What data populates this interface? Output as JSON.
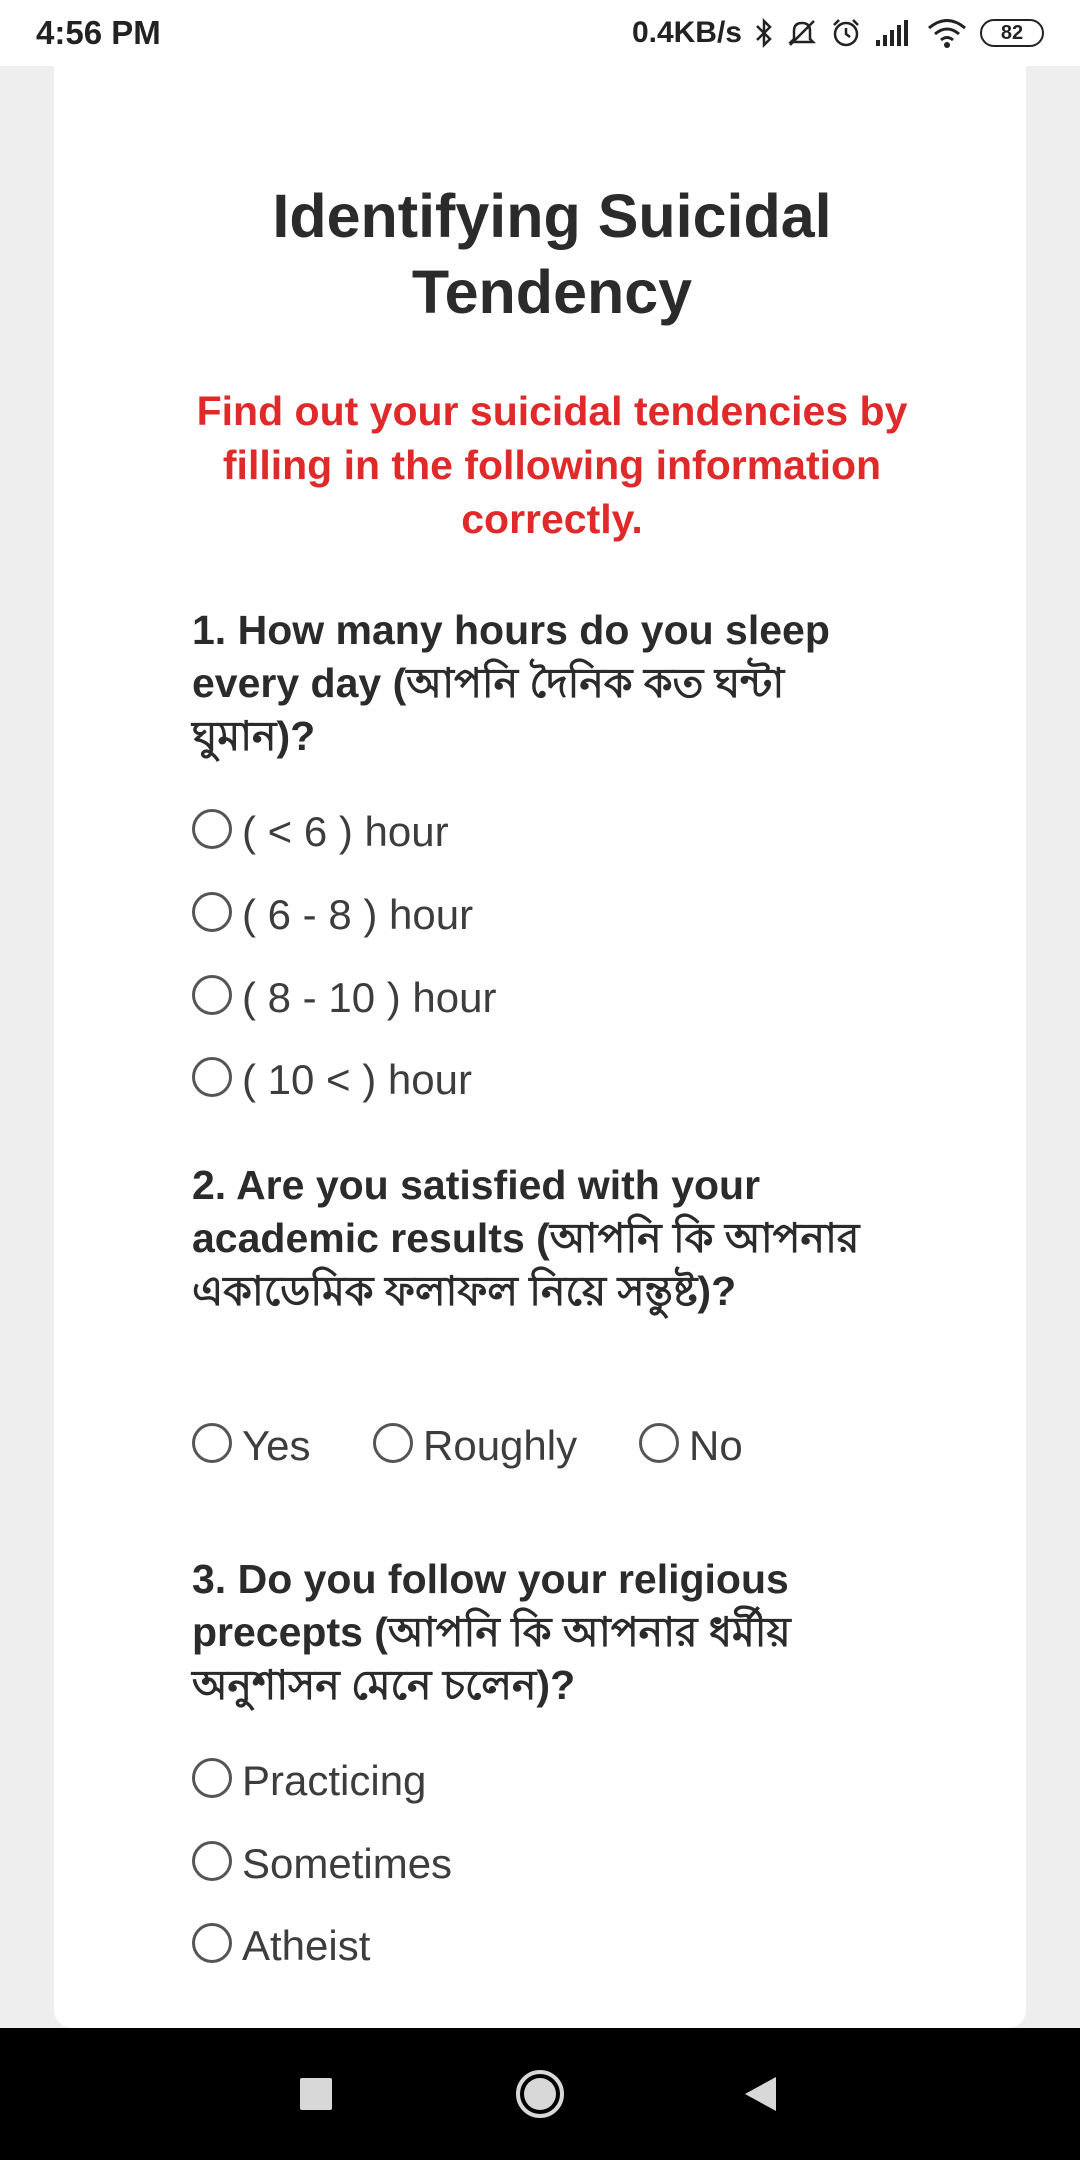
{
  "status_bar": {
    "time": "4:56 PM",
    "network_speed": "0.4KB/s",
    "battery": "82",
    "icons": [
      "bluetooth-icon",
      "mute-icon",
      "alarm-icon",
      "signal-icon",
      "wifi-icon",
      "battery-icon"
    ]
  },
  "form": {
    "title": "Identifying Suicidal Tendency",
    "subtitle": "Find out your suicidal tendencies by filling in the following information correctly.",
    "accent_color": "#e02a2a",
    "questions": [
      {
        "text": "1. How many hours do you sleep every day (আপনি দৈনিক কত ঘন্টা ঘুমান)?",
        "options": [
          "( < 6 ) hour",
          "( 6 - 8 ) hour",
          "( 8 - 10 ) hour",
          "( 10 < ) hour"
        ]
      },
      {
        "text": "2. Are you satisfied with your academic results (আপনি কি আপনার একাডেমিক ফলাফল নিয়ে সন্তুষ্ট)?",
        "options": [
          "Yes",
          "Roughly",
          "No"
        ]
      },
      {
        "text": "3. Do you follow your religious precepts (আপনি কি আপনার ধর্মীয় অনুশাসন মেনে চলেন)?",
        "options": [
          "Practicing",
          "Sometimes",
          "Atheist"
        ]
      }
    ]
  },
  "nav_bar": {
    "buttons": [
      "recents-icon",
      "home-icon",
      "back-icon"
    ]
  }
}
